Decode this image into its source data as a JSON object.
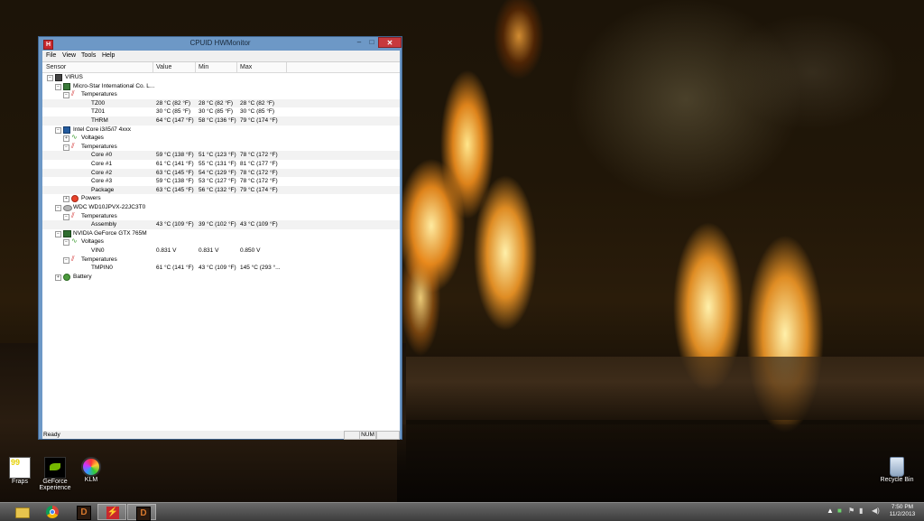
{
  "window": {
    "title": "CPUID HWMonitor",
    "app_icon_letter": "H",
    "close_glyph": "✕",
    "min_glyph": "–",
    "max_glyph": "□"
  },
  "menu": [
    "File",
    "View",
    "Tools",
    "Help"
  ],
  "columns": {
    "sensor": "Sensor",
    "value": "Value",
    "min": "Min",
    "max": "Max"
  },
  "tree": [
    {
      "level": 0,
      "expander": "−",
      "icon": "computer-icon",
      "label": "VIRUS",
      "value": "",
      "min": "",
      "max": ""
    },
    {
      "level": 1,
      "expander": "−",
      "icon": "motherboard-icon",
      "label": "Micro-Star International Co. L...",
      "value": "",
      "min": "",
      "max": ""
    },
    {
      "level": 2,
      "expander": "−",
      "icon": "thermometer-icon",
      "label": "Temperatures",
      "value": "",
      "min": "",
      "max": ""
    },
    {
      "level": 3,
      "expander": "",
      "icon": "",
      "label": "TZ00",
      "value": "28 °C  (82 °F)",
      "min": "28 °C  (82 °F)",
      "max": "28 °C  (82 °F)"
    },
    {
      "level": 3,
      "expander": "",
      "icon": "",
      "label": "TZ01",
      "value": "30 °C  (85 °F)",
      "min": "30 °C  (85 °F)",
      "max": "30 °C  (85 °F)"
    },
    {
      "level": 3,
      "expander": "",
      "icon": "",
      "label": "THRM",
      "value": "64 °C  (147 °F)",
      "min": "58 °C  (136 °F)",
      "max": "79 °C  (174 °F)"
    },
    {
      "level": 1,
      "expander": "−",
      "icon": "cpu-icon",
      "label": "Intel Core i3/i5/i7 4xxx",
      "value": "",
      "min": "",
      "max": ""
    },
    {
      "level": 2,
      "expander": "+",
      "icon": "voltage-icon",
      "label": "Voltages",
      "value": "",
      "min": "",
      "max": ""
    },
    {
      "level": 2,
      "expander": "−",
      "icon": "thermometer-icon",
      "label": "Temperatures",
      "value": "",
      "min": "",
      "max": ""
    },
    {
      "level": 3,
      "expander": "",
      "icon": "",
      "label": "Core #0",
      "value": "59 °C  (138 °F)",
      "min": "51 °C  (123 °F)",
      "max": "78 °C  (172 °F)"
    },
    {
      "level": 3,
      "expander": "",
      "icon": "",
      "label": "Core #1",
      "value": "61 °C  (141 °F)",
      "min": "55 °C  (131 °F)",
      "max": "81 °C  (177 °F)"
    },
    {
      "level": 3,
      "expander": "",
      "icon": "",
      "label": "Core #2",
      "value": "63 °C  (145 °F)",
      "min": "54 °C  (129 °F)",
      "max": "78 °C  (172 °F)"
    },
    {
      "level": 3,
      "expander": "",
      "icon": "",
      "label": "Core #3",
      "value": "59 °C  (138 °F)",
      "min": "53 °C  (127 °F)",
      "max": "78 °C  (172 °F)"
    },
    {
      "level": 3,
      "expander": "",
      "icon": "",
      "label": "Package",
      "value": "63 °C  (145 °F)",
      "min": "56 °C  (132 °F)",
      "max": "79 °C  (174 °F)"
    },
    {
      "level": 2,
      "expander": "+",
      "icon": "power-icon",
      "label": "Powers",
      "value": "",
      "min": "",
      "max": ""
    },
    {
      "level": 1,
      "expander": "−",
      "icon": "hard-drive-icon",
      "label": "WDC WD10JPVX-22JC3T0",
      "value": "",
      "min": "",
      "max": ""
    },
    {
      "level": 2,
      "expander": "−",
      "icon": "thermometer-icon",
      "label": "Temperatures",
      "value": "",
      "min": "",
      "max": ""
    },
    {
      "level": 3,
      "expander": "",
      "icon": "",
      "label": "Assembly",
      "value": "43 °C  (109 °F)",
      "min": "39 °C  (102 °F)",
      "max": "43 °C  (109 °F)"
    },
    {
      "level": 1,
      "expander": "−",
      "icon": "gpu-icon",
      "label": "NVIDIA GeForce GTX 765M",
      "value": "",
      "min": "",
      "max": ""
    },
    {
      "level": 2,
      "expander": "−",
      "icon": "voltage-icon",
      "label": "Voltages",
      "value": "",
      "min": "",
      "max": ""
    },
    {
      "level": 3,
      "expander": "",
      "icon": "",
      "label": "VIN0",
      "value": "0.831 V",
      "min": "0.831 V",
      "max": "0.850 V"
    },
    {
      "level": 2,
      "expander": "−",
      "icon": "thermometer-icon",
      "label": "Temperatures",
      "value": "",
      "min": "",
      "max": ""
    },
    {
      "level": 3,
      "expander": "",
      "icon": "",
      "label": "TMPIN0",
      "value": "61 °C  (141 °F)",
      "min": "43 °C  (109 °F)",
      "max": "145 °C  (293 °..."
    },
    {
      "level": 1,
      "expander": "+",
      "icon": "battery-icon",
      "label": "Battery",
      "value": "",
      "min": "",
      "max": ""
    }
  ],
  "status": {
    "text": "Ready",
    "num": "NUM"
  },
  "desktop_icons": [
    {
      "label": "Fraps",
      "badge": "99",
      "icon": "fraps-icon"
    },
    {
      "label": "GeForce Experience",
      "icon": "geforce-icon"
    },
    {
      "label": "KLM",
      "icon": "klm-icon"
    },
    {
      "label": "Recycle Bin",
      "icon": "recycle-bin-icon"
    }
  ],
  "taskbar": {
    "apps": [
      {
        "icon": "file-explorer-icon",
        "glyph": ""
      },
      {
        "icon": "chrome-icon",
        "glyph": ""
      },
      {
        "icon": "diablo-icon",
        "glyph": "D"
      },
      {
        "icon": "hwmonitor-icon",
        "glyph": "⚡"
      },
      {
        "icon": "diablo-icon",
        "glyph": "D"
      }
    ],
    "time": "7:50 PM",
    "date": "11/2/2013",
    "tray_chevron": "▲"
  }
}
